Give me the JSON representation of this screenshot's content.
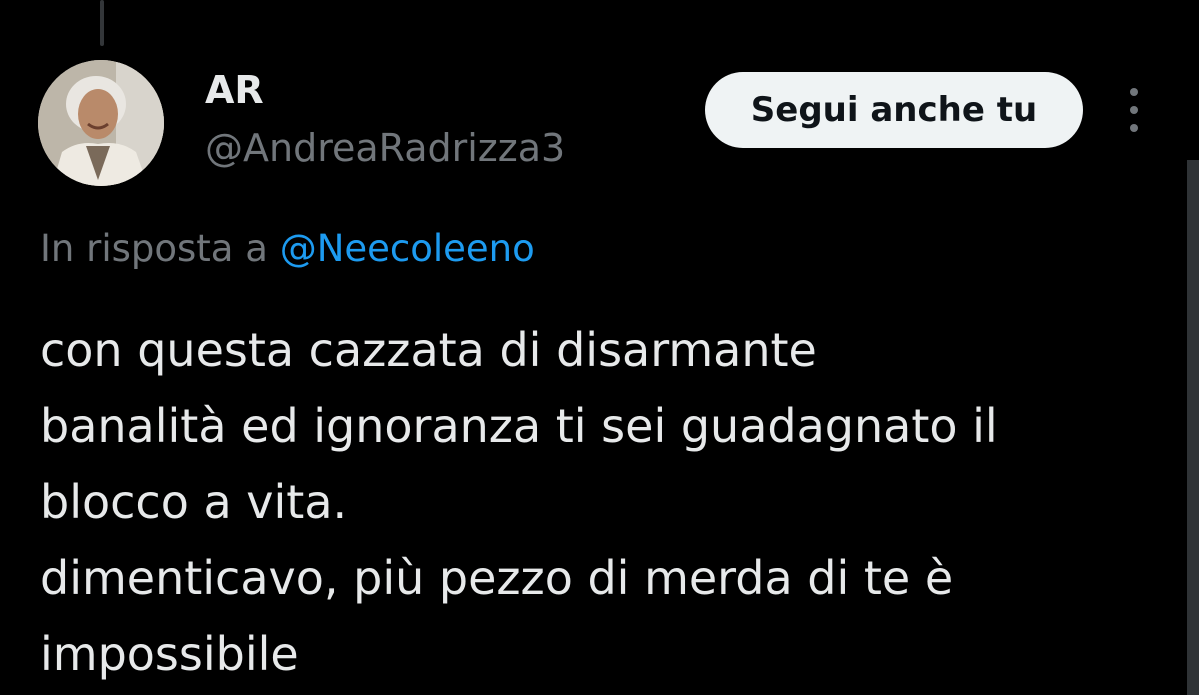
{
  "author": {
    "display_name": "AR",
    "handle": "@AndreaRadrizza3"
  },
  "actions": {
    "follow_label": "Segui anche tu"
  },
  "reply": {
    "prefix": "In risposta a",
    "mention": "@Neecoleeno"
  },
  "tweet": {
    "lines": [
      "con questa cazzata di disarmante",
      "banalità ed ignoranza ti sei guadagnato il",
      "blocco a vita.",
      "dimenticavo, più pezzo di merda di te è",
      "impossibile"
    ]
  },
  "colors": {
    "background": "#000000",
    "primary_text": "#e7e9ea",
    "secondary_text": "#71767b",
    "link": "#1d9bf0",
    "button_bg": "#eff3f4",
    "button_text": "#0f1419"
  },
  "icons": {
    "more": "more-vertical-icon",
    "avatar": "avatar"
  }
}
